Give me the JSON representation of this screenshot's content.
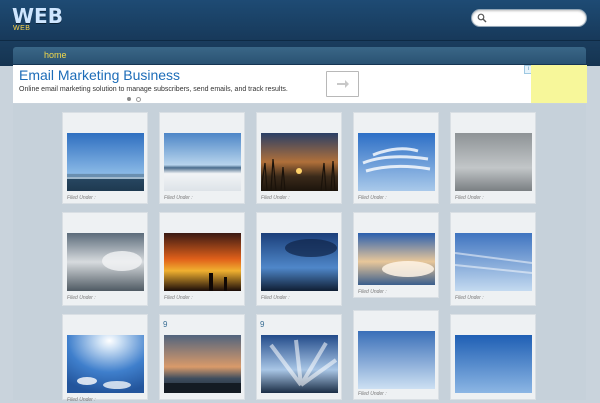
{
  "header": {
    "logo": "WEB",
    "logo_sub": "WEB",
    "search_placeholder": "",
    "search_value": ""
  },
  "nav": {
    "items": [
      {
        "label": "home"
      }
    ]
  },
  "ad": {
    "title": "Email Marketing Business",
    "description": "Online email marketing solution to manage subscribers, send emails, and track results.",
    "choices_label": "i"
  },
  "gallery": {
    "filed_label": "Filed Under :",
    "number_label": "9",
    "icons": [
      "harbor-image",
      "snow-beach-image",
      "sunset-reeds-image",
      "cirrus-sky-image",
      "overcast-sky-image",
      "grey-clouds-image",
      "orange-sunset-image",
      "blue-dusk-image",
      "cumulus-image",
      "streaked-sky-image",
      "sun-glare-image",
      "harbor-sunset-image",
      "radiating-clouds-image",
      "clear-sky-image",
      "blue-gradient-image"
    ]
  },
  "colors": {
    "header": "#1e4b74",
    "nav": "#2a5273",
    "nav_link": "#f2d94a",
    "ad_title": "#1c6cb8",
    "content_bg": "#c6d1da",
    "card_bg": "#eef1f3",
    "ad_side": "#f7f79a"
  }
}
